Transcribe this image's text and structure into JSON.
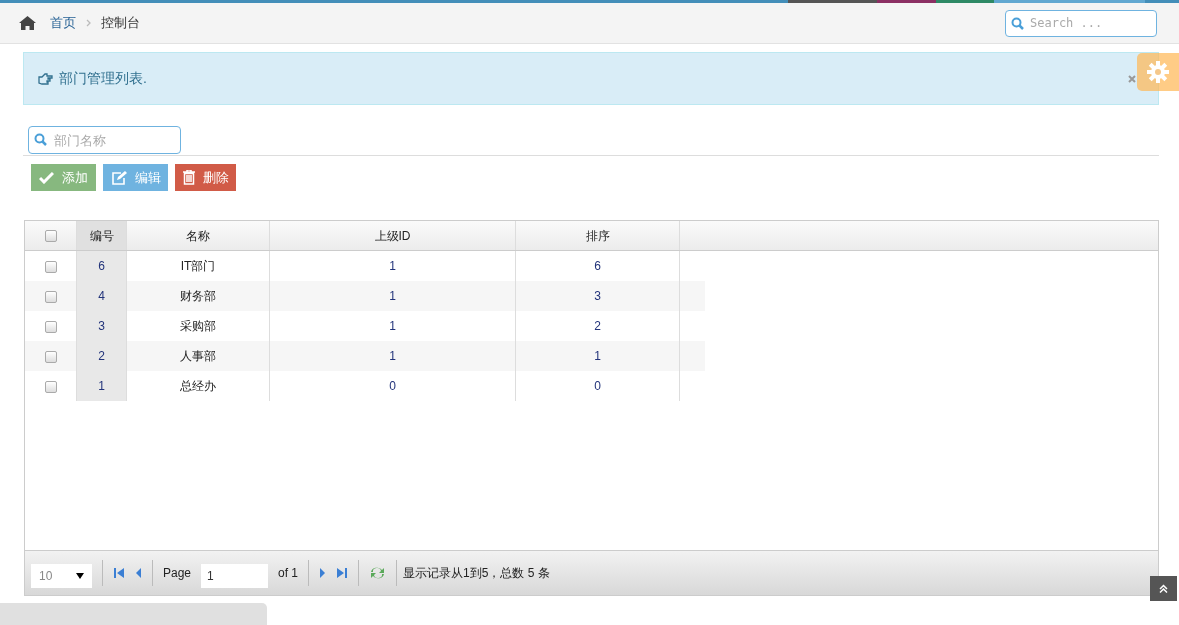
{
  "breadcrumb": [
    "首页",
    "控制台"
  ],
  "search": {
    "placeholder": "Search ..."
  },
  "alert": {
    "text": "部门管理列表."
  },
  "filter": {
    "placeholder": "部门名称"
  },
  "buttons": [
    {
      "kind": "add",
      "label": "添加"
    },
    {
      "kind": "edit",
      "label": "编辑"
    },
    {
      "kind": "delete",
      "label": "删除"
    }
  ],
  "table": {
    "all_checked": false,
    "columns": [
      "编号",
      "名称",
      "上级ID",
      "排序"
    ],
    "rows": [
      {
        "checked": false,
        "cells": [
          "6",
          "IT部门",
          "1",
          "6"
        ]
      },
      {
        "checked": false,
        "cells": [
          "4",
          "财务部",
          "1",
          "3"
        ]
      },
      {
        "checked": false,
        "cells": [
          "3",
          "采购部",
          "1",
          "2"
        ]
      },
      {
        "checked": false,
        "cells": [
          "2",
          "人事部",
          "1",
          "1"
        ]
      },
      {
        "checked": false,
        "cells": [
          "1",
          "总经办",
          "0",
          "0"
        ]
      }
    ]
  },
  "pager": {
    "page_size": "10",
    "page_label": "Page",
    "page": "1",
    "of": "of 1",
    "summary": "显示记录从1到5，总数 5 条"
  }
}
